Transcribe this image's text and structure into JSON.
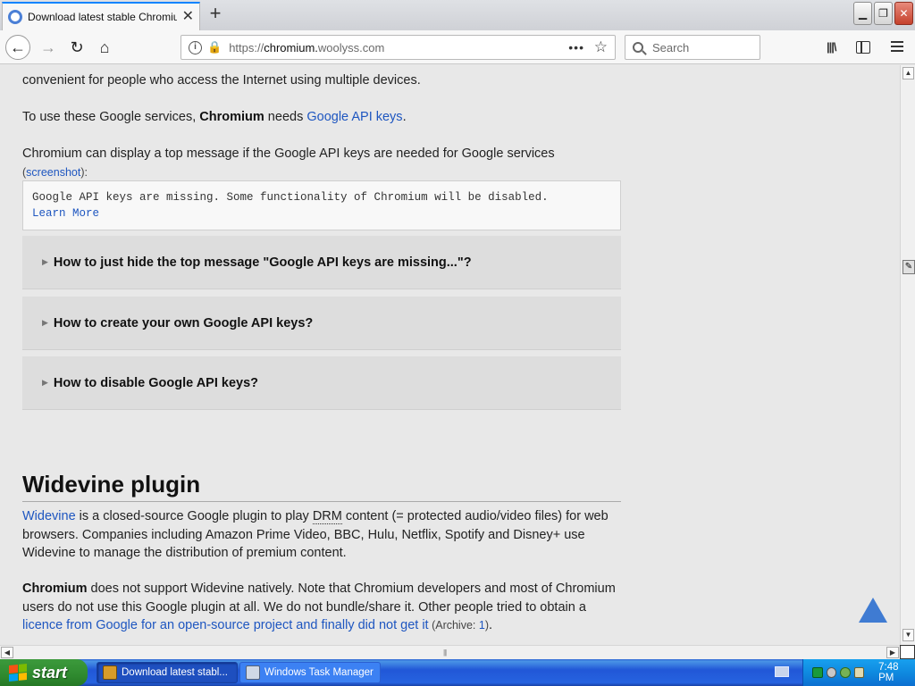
{
  "browser": {
    "tab_title": "Download latest stable Chromium b",
    "tab_close": "✕",
    "new_tab": "+",
    "url": {
      "protocol": "https://",
      "host": "chromium.",
      "domain": "woolyss.com"
    },
    "page_actions": "•••",
    "search_placeholder": "Search",
    "library_icon": "|||\\"
  },
  "content": {
    "line_convenient": "convenient for people who access the Internet using multiple devices.",
    "api_keys_sentence": {
      "before": "To use these Google services, ",
      "bold": "Chromium",
      "middle": " needs ",
      "link": "Google API keys",
      "after": "."
    },
    "top_message_sentence": {
      "text": "Chromium can display a top message if the Google API keys are needed for Google services",
      "paren_open": "(",
      "link": "screenshot",
      "paren_close": "):"
    },
    "code_box": {
      "line1": "Google API keys are missing. Some functionality of Chromium will be disabled.",
      "link": "Learn More"
    },
    "accordions": [
      {
        "label": "How to just hide the top message \"Google API keys are missing...\"?"
      },
      {
        "label": "How to create your own Google API keys?"
      },
      {
        "label": "How to disable Google API keys?"
      }
    ],
    "widevine": {
      "heading": "Widevine plugin",
      "p1": {
        "link": "Widevine",
        "text1": " is a closed-source Google plugin to play ",
        "abbr": "DRM",
        "text2": " content (= protected audio/video files) for web browsers. Companies including Amazon Prime Video, BBC, Hulu, Netflix, Spotify and Disney+ use Widevine to manage the distribution of premium content."
      },
      "p2": {
        "bold": "Chromium",
        "text": " does not support Widevine natively. Note that Chromium developers and most of Chromium users do not use this Google plugin at all. We do not bundle/share it. Other people tried to obtain a ",
        "link": "licence from Google for an open-source project and finally did not get it",
        "archive_label": " (Archive: ",
        "archive_link": "1",
        "archive_close": ")",
        "end": "."
      }
    }
  },
  "taskbar": {
    "start_label": "start",
    "items": [
      {
        "label": "Download latest stabl..."
      },
      {
        "label": "Windows Task Manager"
      }
    ],
    "clock": "7:48 PM"
  },
  "colors": {
    "link": "#1e56c0",
    "page_bg": "#e8e8e8",
    "accordion_bg": "#dddddd",
    "scroll_top_arrow": "#3f7bd2",
    "taskbar_blue": "#2157d7",
    "start_green": "#2f8a2f"
  }
}
